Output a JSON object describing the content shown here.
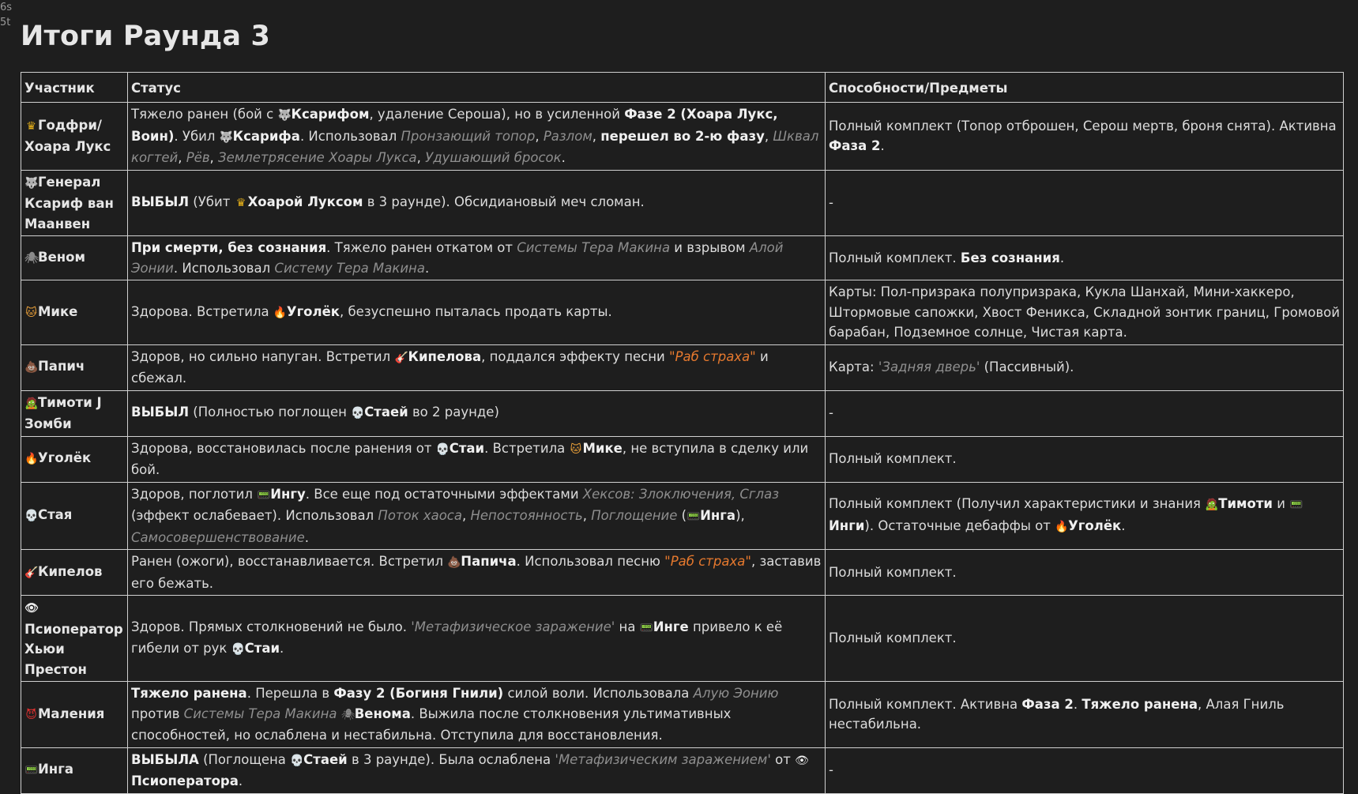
{
  "corner_text": [
    "6s",
    "5t"
  ],
  "page_title": "Итоги Раунда 3",
  "headers": [
    "Участник",
    "Статус",
    "Способности/Предметы"
  ],
  "icons": {
    "crown": "♛",
    "wolf": "🐺",
    "spider": "🕷",
    "cat": "🐱",
    "poop": "💩",
    "zombie": "🧟",
    "fire": "🔥",
    "skull": "💀",
    "guitar": "🎸",
    "eye": "👁",
    "devil": "😈",
    "robot": "📟"
  },
  "colors": {
    "background": "#1e1e1e",
    "text": "#dcdcdc",
    "italic_ref": "#8f8f8f",
    "song": "#e6792e",
    "border": "#d0d0d0"
  },
  "rows": [
    {
      "name_icon": "crown-icon",
      "name": "Годфри/ Хоара Лукс",
      "status": [
        {
          "t": "Тяжело ранен (бой с "
        },
        {
          "icon": "wolf"
        },
        {
          "b": "Ксарифом"
        },
        {
          "t": ", удаление Сероша), но в усиленной "
        },
        {
          "b": "Фазе 2 (Хоара Лукс, Воин)"
        },
        {
          "t": ". Убил "
        },
        {
          "icon": "wolf"
        },
        {
          "b": "Ксарифа"
        },
        {
          "t": ". Использовал "
        },
        {
          "i": "Пронзающий топор"
        },
        {
          "t": ", "
        },
        {
          "i": "Разлом"
        },
        {
          "t": ", "
        },
        {
          "b": "перешел во 2-ю фазу"
        },
        {
          "t": ", "
        },
        {
          "i": "Шквал когтей"
        },
        {
          "t": ", "
        },
        {
          "i": "Рёв"
        },
        {
          "t": ", "
        },
        {
          "i": "Землетрясение Хоары Лукса"
        },
        {
          "t": ", "
        },
        {
          "i": "Удушающий бросок"
        },
        {
          "t": "."
        }
      ],
      "abilities": [
        {
          "t": "Полный комплект (Топор отброшен, Серош мертв, броня снята). Активна "
        },
        {
          "b": "Фаза 2"
        },
        {
          "t": "."
        }
      ]
    },
    {
      "name_icon": "wolf-icon",
      "name": "Генерал Ксариф ван Маанвен",
      "status": [
        {
          "b": "ВЫБЫЛ"
        },
        {
          "t": " (Убит "
        },
        {
          "icon": "crown"
        },
        {
          "b": "Хоарой Луксом"
        },
        {
          "t": " в 3 раунде). Обсидиановый меч сломан."
        }
      ],
      "abilities": [
        {
          "t": "-"
        }
      ]
    },
    {
      "name_icon": "spider-icon",
      "name": "Веном",
      "status": [
        {
          "b": "При смерти, без сознания"
        },
        {
          "t": ". Тяжело ранен откатом от "
        },
        {
          "i": "Системы Тера Макина"
        },
        {
          "t": " и взрывом "
        },
        {
          "i": "Алой Эонии"
        },
        {
          "t": ". Использовал "
        },
        {
          "i": "Систему Тера Макина"
        },
        {
          "t": "."
        }
      ],
      "abilities": [
        {
          "t": "Полный комплект. "
        },
        {
          "b": "Без сознания"
        },
        {
          "t": "."
        }
      ]
    },
    {
      "name_icon": "cat-icon",
      "name": "Мике",
      "status": [
        {
          "t": "Здорова. Встретила "
        },
        {
          "icon": "fire"
        },
        {
          "b": "Уголёк"
        },
        {
          "t": ", безуспешно пыталась продать карты."
        }
      ],
      "abilities": [
        {
          "t": "Карты: Пол-призрака полупризрака, Кукла Шанхай, Мини-хаккеро, Штормовые сапожки, Хвост Феникса, Складной зонтик границ, Громовой барабан, Подземное солнце, Чистая карта."
        }
      ]
    },
    {
      "name_icon": "poop-icon",
      "name": "Папич",
      "status": [
        {
          "t": "Здоров, но сильно напуган. Встретил "
        },
        {
          "icon": "guitar"
        },
        {
          "b": "Кипелова"
        },
        {
          "t": ", поддался эффекту песни "
        },
        {
          "s": "\"Раб страха\""
        },
        {
          "t": " и сбежал."
        }
      ],
      "abilities": [
        {
          "t": "Карта: "
        },
        {
          "i": "'Задняя дверь'"
        },
        {
          "t": " (Пассивный)."
        }
      ]
    },
    {
      "name_icon": "zombie-icon",
      "name": "Тимоти J Зомби",
      "status": [
        {
          "b": "ВЫБЫЛ"
        },
        {
          "t": " (Полностью поглощен "
        },
        {
          "icon": "skull"
        },
        {
          "b": "Стаей"
        },
        {
          "t": " во 2 раунде)"
        }
      ],
      "abilities": [
        {
          "t": "-"
        }
      ]
    },
    {
      "name_icon": "fire-icon",
      "name": "Уголёк",
      "status": [
        {
          "t": "Здорова, восстановилась после ранения от "
        },
        {
          "icon": "skull"
        },
        {
          "b": "Стаи"
        },
        {
          "t": ". Встретила "
        },
        {
          "icon": "cat"
        },
        {
          "b": "Мике"
        },
        {
          "t": ", не вступила в сделку или бой."
        }
      ],
      "abilities": [
        {
          "t": "Полный комплект."
        }
      ]
    },
    {
      "name_icon": "skull-icon",
      "name": "Стая",
      "status": [
        {
          "t": "Здоров, поглотил "
        },
        {
          "icon": "robot"
        },
        {
          "b": "Ингу"
        },
        {
          "t": ". Все еще под остаточными эффектами "
        },
        {
          "i": "Хексов: Злоключения, Сглаз"
        },
        {
          "t": " (эффект ослабевает). Использовал "
        },
        {
          "i": "Поток хаоса"
        },
        {
          "t": ", "
        },
        {
          "i": "Непостоянность"
        },
        {
          "t": ", "
        },
        {
          "i": "Поглощение"
        },
        {
          "t": " ("
        },
        {
          "icon": "robot"
        },
        {
          "b": "Инга"
        },
        {
          "t": "), "
        },
        {
          "i": "Самосовершенствование"
        },
        {
          "t": "."
        }
      ],
      "abilities": [
        {
          "t": "Полный комплект (Получил характеристики и знания "
        },
        {
          "icon": "zombie"
        },
        {
          "b": "Тимоти"
        },
        {
          "t": " и "
        },
        {
          "icon": "robot"
        },
        {
          "b": "Инги"
        },
        {
          "t": "). Остаточные дебаффы от "
        },
        {
          "icon": "fire"
        },
        {
          "b": "Уголёк"
        },
        {
          "t": "."
        }
      ]
    },
    {
      "name_icon": "guitar-icon",
      "name": "Кипелов",
      "status": [
        {
          "t": "Ранен (ожоги), восстанавливается. Встретил "
        },
        {
          "icon": "poop"
        },
        {
          "b": "Папича"
        },
        {
          "t": ". Использовал песню "
        },
        {
          "s": "\"Раб страха\""
        },
        {
          "t": ", заставив его бежать."
        }
      ],
      "abilities": [
        {
          "t": "Полный комплект."
        }
      ]
    },
    {
      "name_icon": "eye-icon",
      "name": "Псиоператор Хьюи Престон",
      "icon_block": true,
      "status": [
        {
          "t": "Здоров. Прямых столкновений не было. "
        },
        {
          "i": "'Метафизическое заражение'"
        },
        {
          "t": " на "
        },
        {
          "icon": "robot"
        },
        {
          "b": "Инге"
        },
        {
          "t": " привело к её гибели от рук "
        },
        {
          "icon": "skull"
        },
        {
          "b": "Стаи"
        },
        {
          "t": "."
        }
      ],
      "abilities": [
        {
          "t": "Полный комплект."
        }
      ]
    },
    {
      "name_icon": "devil-icon",
      "name": "Маления",
      "status": [
        {
          "b": "Тяжело ранена"
        },
        {
          "t": ". Перешла в "
        },
        {
          "b": "Фазу 2 (Богиня Гнили)"
        },
        {
          "t": " силой воли. Использовала "
        },
        {
          "i": "Алую Эонию"
        },
        {
          "t": " против "
        },
        {
          "i": "Системы Тера Макина"
        },
        {
          "t": " "
        },
        {
          "icon": "spider"
        },
        {
          "b": "Венома"
        },
        {
          "t": ". Выжила после столкновения ультимативных способностей, но ослаблена и нестабильна. Отступила для восстановления."
        }
      ],
      "abilities": [
        {
          "t": "Полный комплект. Активна "
        },
        {
          "b": "Фаза 2"
        },
        {
          "t": ". "
        },
        {
          "b": "Тяжело ранена"
        },
        {
          "t": ", Алая Гниль нестабильна."
        }
      ]
    },
    {
      "name_icon": "robot-icon",
      "name": "Инга",
      "status": [
        {
          "b": "ВЫБЫЛА"
        },
        {
          "t": " (Поглощена "
        },
        {
          "icon": "skull"
        },
        {
          "b": "Стаей"
        },
        {
          "t": " в 3 раунде). Была ослаблена "
        },
        {
          "i": "'Метафизическим заражением'"
        },
        {
          "t": " от "
        },
        {
          "icon": "eye"
        },
        {
          "b": "Псиоператора"
        },
        {
          "t": "."
        }
      ],
      "abilities": [
        {
          "t": "-"
        }
      ]
    }
  ]
}
